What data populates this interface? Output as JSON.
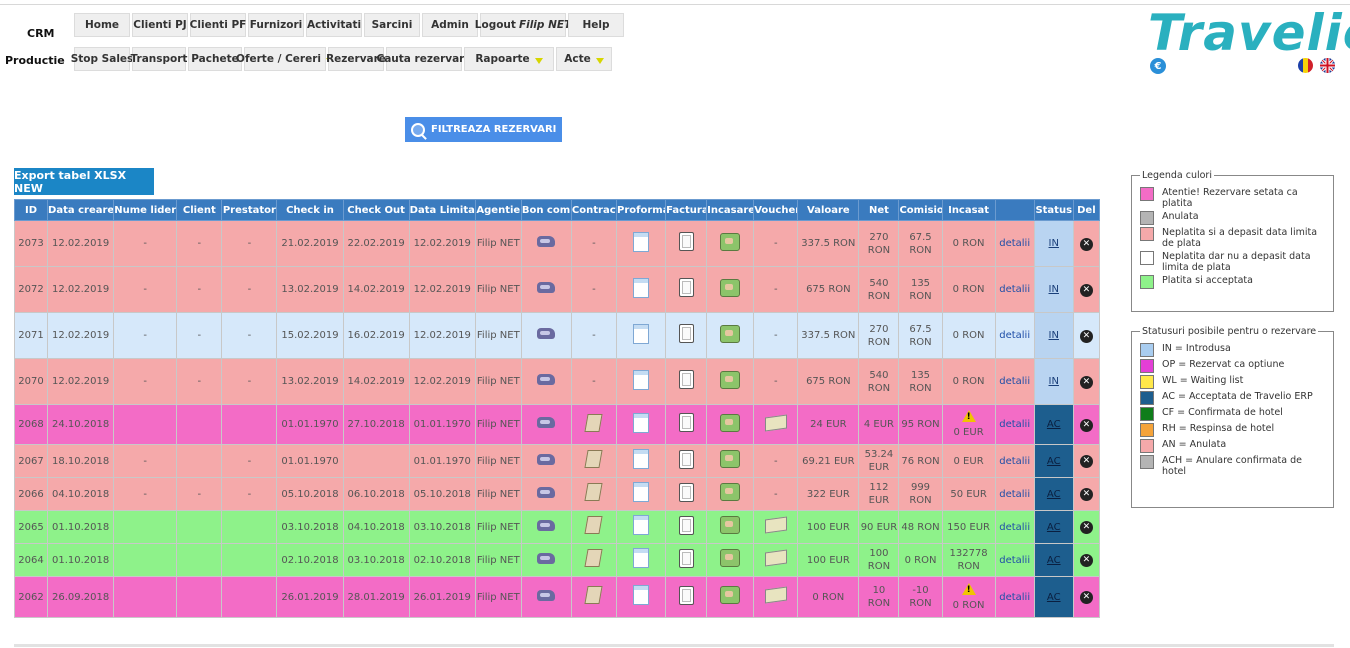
{
  "app": {
    "crm_label": "CRM",
    "productie_label": "Productie",
    "logo_text": "Travelio",
    "euro_symbol": "€"
  },
  "nav": {
    "row1": [
      {
        "label": "Home",
        "w": 56
      },
      {
        "label": "Clienti PJ",
        "w": 56
      },
      {
        "label": "Clienti PF",
        "w": 56
      },
      {
        "label": "Furnizori",
        "w": 56
      },
      {
        "label": "Activitati",
        "w": 56
      },
      {
        "label": "Sarcini",
        "w": 56
      },
      {
        "label": "Admin",
        "w": 56
      }
    ],
    "logout_label": "Logout",
    "logout_user": "Filip NET",
    "help_label": "Help",
    "row2": [
      {
        "label": "Stop Sales",
        "caret": false
      },
      {
        "label": "Transport",
        "caret": false
      },
      {
        "label": "Pachete",
        "caret": false
      },
      {
        "label": "Oferte / Cereri",
        "caret": true
      },
      {
        "label": "Rezervare",
        "caret": false
      },
      {
        "label": "Cauta rezervare",
        "caret": false
      },
      {
        "label": "Rapoarte",
        "caret": true
      },
      {
        "label": "Acte",
        "caret": true
      }
    ]
  },
  "filter_button_label": "FILTREAZA REZERVARI",
  "export_button_label": "Export tabel XLSX NEW",
  "table": {
    "headers": [
      "ID",
      "Data creare",
      "Nume lider",
      "Client",
      "Prestator",
      "Check in",
      "Check Out",
      "Data Limita",
      "Agentie",
      "Bon com.",
      "Contract",
      "Proforma",
      "Factura",
      "Incasare",
      "Voucher",
      "Valoare",
      "Net",
      "Comision",
      "Incasat",
      "",
      "Status",
      "Del"
    ],
    "rows": [
      {
        "color": "pink",
        "id": "2073",
        "created": "12.02.2019",
        "lider": "-",
        "client": "-",
        "prestator": "-",
        "checkin": "21.02.2019",
        "checkout": "22.02.2019",
        "limita": "12.02.2019",
        "agentie": "Filip NET",
        "contract": "-",
        "voucher": "-",
        "valoare": "337.5 RON",
        "net": "270 RON",
        "comision": "67.5 RON",
        "incasat": "0 RON",
        "warn": false,
        "detalii": "detalii",
        "status": "IN"
      },
      {
        "color": "pink",
        "id": "2072",
        "created": "12.02.2019",
        "lider": "-",
        "client": "-",
        "prestator": "-",
        "checkin": "13.02.2019",
        "checkout": "14.02.2019",
        "limita": "12.02.2019",
        "agentie": "Filip NET",
        "contract": "-",
        "voucher": "-",
        "valoare": "675 RON",
        "net": "540 RON",
        "comision": "135 RON",
        "incasat": "0 RON",
        "warn": false,
        "detalii": "detalii",
        "status": "IN"
      },
      {
        "color": "blue",
        "id": "2071",
        "created": "12.02.2019",
        "lider": "-",
        "client": "-",
        "prestator": "-",
        "checkin": "15.02.2019",
        "checkout": "16.02.2019",
        "limita": "12.02.2019",
        "agentie": "Filip NET",
        "contract": "-",
        "voucher": "-",
        "valoare": "337.5 RON",
        "net": "270 RON",
        "comision": "67.5 RON",
        "incasat": "0 RON",
        "warn": false,
        "detalii": "detalii",
        "status": "IN"
      },
      {
        "color": "pink",
        "id": "2070",
        "created": "12.02.2019",
        "lider": "-",
        "client": "-",
        "prestator": "-",
        "checkin": "13.02.2019",
        "checkout": "14.02.2019",
        "limita": "12.02.2019",
        "agentie": "Filip NET",
        "contract": "-",
        "voucher": "-",
        "valoare": "675 RON",
        "net": "540 RON",
        "comision": "135 RON",
        "incasat": "0 RON",
        "warn": false,
        "detalii": "detalii",
        "status": "IN"
      },
      {
        "color": "magenta",
        "id": "2068",
        "created": "24.10.2018",
        "lider": "",
        "client": "",
        "prestator": "",
        "checkin": "01.01.1970",
        "checkout": "27.10.2018",
        "limita": "01.01.1970",
        "agentie": "Filip NET",
        "contract": "icon",
        "voucher": "icon",
        "valoare": "24 EUR",
        "net": "4 EUR",
        "comision": "95 RON",
        "incasat": "0 EUR",
        "warn": true,
        "detalii": "detalii",
        "status": "AC"
      },
      {
        "color": "pink",
        "id": "2067",
        "created": "18.10.2018",
        "lider": "-",
        "client": "",
        "prestator": "-",
        "checkin": "01.01.1970",
        "checkout": "",
        "limita": "01.01.1970",
        "agentie": "Filip NET",
        "contract": "icon",
        "voucher": "-",
        "valoare": "69.21 EUR",
        "net": "53.24 EUR",
        "comision": "76 RON",
        "incasat": "0 EUR",
        "warn": false,
        "detalii": "detalii",
        "status": "AC"
      },
      {
        "color": "pink",
        "id": "2066",
        "created": "04.10.2018",
        "lider": "-",
        "client": "-",
        "prestator": "-",
        "checkin": "05.10.2018",
        "checkout": "06.10.2018",
        "limita": "05.10.2018",
        "agentie": "Filip NET",
        "contract": "icon",
        "voucher": "-",
        "valoare": "322 EUR",
        "net": "112 EUR",
        "comision": "999 RON",
        "incasat": "50 EUR",
        "warn": false,
        "detalii": "detalii",
        "status": "AC"
      },
      {
        "color": "green",
        "id": "2065",
        "created": "01.10.2018",
        "lider": "",
        "client": "",
        "prestator": "",
        "checkin": "03.10.2018",
        "checkout": "04.10.2018",
        "limita": "03.10.2018",
        "agentie": "Filip NET",
        "contract": "icon",
        "voucher": "icon",
        "valoare": "100 EUR",
        "net": "90 EUR",
        "comision": "48 RON",
        "incasat": "150 EUR",
        "warn": false,
        "detalii": "detalii",
        "status": "AC"
      },
      {
        "color": "green",
        "id": "2064",
        "created": "01.10.2018",
        "lider": "",
        "client": "",
        "prestator": "",
        "checkin": "02.10.2018",
        "checkout": "03.10.2018",
        "limita": "02.10.2018",
        "agentie": "Filip NET",
        "contract": "icon",
        "voucher": "icon",
        "valoare": "100 EUR",
        "net": "100 RON",
        "comision": "0 RON",
        "incasat": "132778 RON",
        "warn": false,
        "detalii": "detalii",
        "status": "AC"
      },
      {
        "color": "magenta",
        "id": "2062",
        "created": "26.09.2018",
        "lider": "",
        "client": "",
        "prestator": "",
        "checkin": "26.01.2019",
        "checkout": "28.01.2019",
        "limita": "26.01.2019",
        "agentie": "Filip NET",
        "contract": "icon",
        "voucher": "icon",
        "valoare": "0 RON",
        "net": "10 RON",
        "comision": "-10 RON",
        "incasat": "0 RON",
        "warn": true,
        "detalii": "detalii",
        "status": "AC"
      }
    ]
  },
  "legend_colors": {
    "title": "Legenda culori",
    "items": [
      {
        "color": "#f36cc6",
        "text": "Atentie! Rezervare setata ca platita"
      },
      {
        "color": "#b4b4b4",
        "text": "Anulata"
      },
      {
        "color": "#f5a9aa",
        "text": "Neplatita si a depasit data limita de plata"
      },
      {
        "color": "#ffffff",
        "text": "Neplatita dar nu a depasit data limita de plata"
      },
      {
        "color": "#8ef28a",
        "text": "Platita si acceptata"
      }
    ]
  },
  "legend_status": {
    "title": "Statusuri posibile pentru o rezervare",
    "items": [
      {
        "color": "#a9cdf0",
        "text": "IN = Introdusa"
      },
      {
        "color": "#e33fd6",
        "text": "OP = Rezervat ca optiune"
      },
      {
        "color": "#ffe84a",
        "text": "WL = Waiting list"
      },
      {
        "color": "#1d5e8e",
        "text": "AC = Acceptata de Travelio ERP"
      },
      {
        "color": "#0f7d1a",
        "text": "CF = Confirmata de hotel"
      },
      {
        "color": "#f5a33a",
        "text": "RH = Respinsa de hotel"
      },
      {
        "color": "#f5a9aa",
        "text": "AN = Anulata"
      },
      {
        "color": "#b4b4b4",
        "text": "ACH = Anulare confirmata de hotel"
      }
    ]
  }
}
